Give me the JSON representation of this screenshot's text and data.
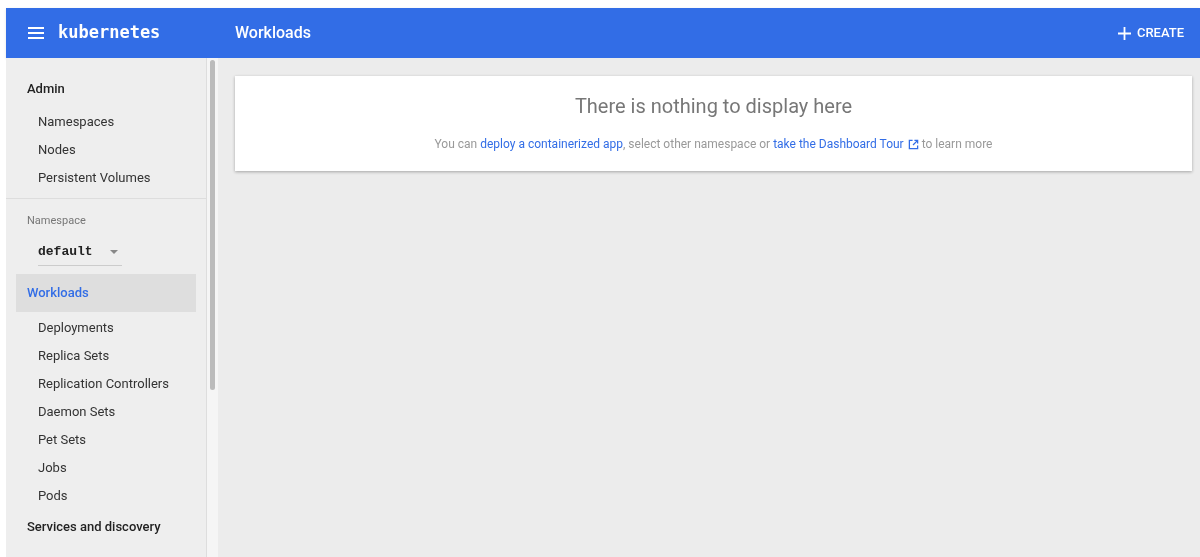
{
  "toolbar": {
    "logo": "kubernetes",
    "title": "Workloads",
    "action": "CREATE"
  },
  "sidebar": {
    "sections": [
      {
        "kind": "group",
        "label": "Admin",
        "selected": false,
        "items": [
          "Namespaces",
          "Nodes",
          "Persistent Volumes"
        ]
      },
      {
        "kind": "namespace",
        "label": "Namespace",
        "value": "default"
      },
      {
        "kind": "group",
        "label": "Workloads",
        "selected": true,
        "items": [
          "Deployments",
          "Replica Sets",
          "Replication Controllers",
          "Daemon Sets",
          "Pet Sets",
          "Jobs",
          "Pods"
        ]
      },
      {
        "kind": "group",
        "label": "Services and discovery",
        "selected": false
      }
    ]
  },
  "empty_state": {
    "title": "There is nothing to display here",
    "parts": [
      {
        "kind": "text",
        "text": "You can "
      },
      {
        "kind": "link",
        "text": "deploy a containerized app"
      },
      {
        "kind": "text",
        "text": ", select other namespace or "
      },
      {
        "kind": "external_link",
        "text": "take the Dashboard Tour"
      },
      {
        "kind": "text",
        "text": " to learn more"
      }
    ]
  }
}
